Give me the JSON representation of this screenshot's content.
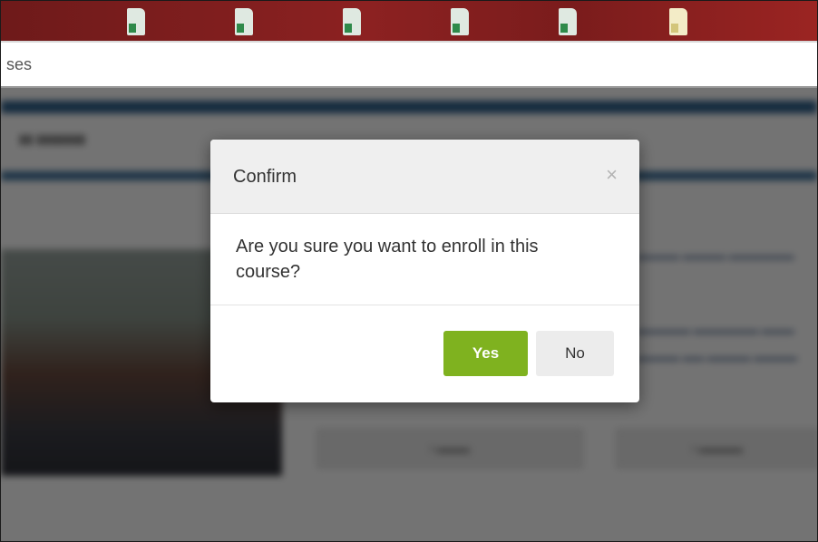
{
  "address_bar": {
    "url_fragment": "ses"
  },
  "desktop": {
    "file_icons": [
      "spreadsheet-file-icon",
      "spreadsheet-file-icon",
      "spreadsheet-file-icon",
      "spreadsheet-file-icon",
      "spreadsheet-file-icon",
      "document-file-icon"
    ]
  },
  "modal": {
    "title": "Confirm",
    "close_glyph": "×",
    "message": "Are you sure you want to enroll in this course?",
    "yes_label": "Yes",
    "no_label": "No",
    "yes_color": "#7fb21f"
  }
}
